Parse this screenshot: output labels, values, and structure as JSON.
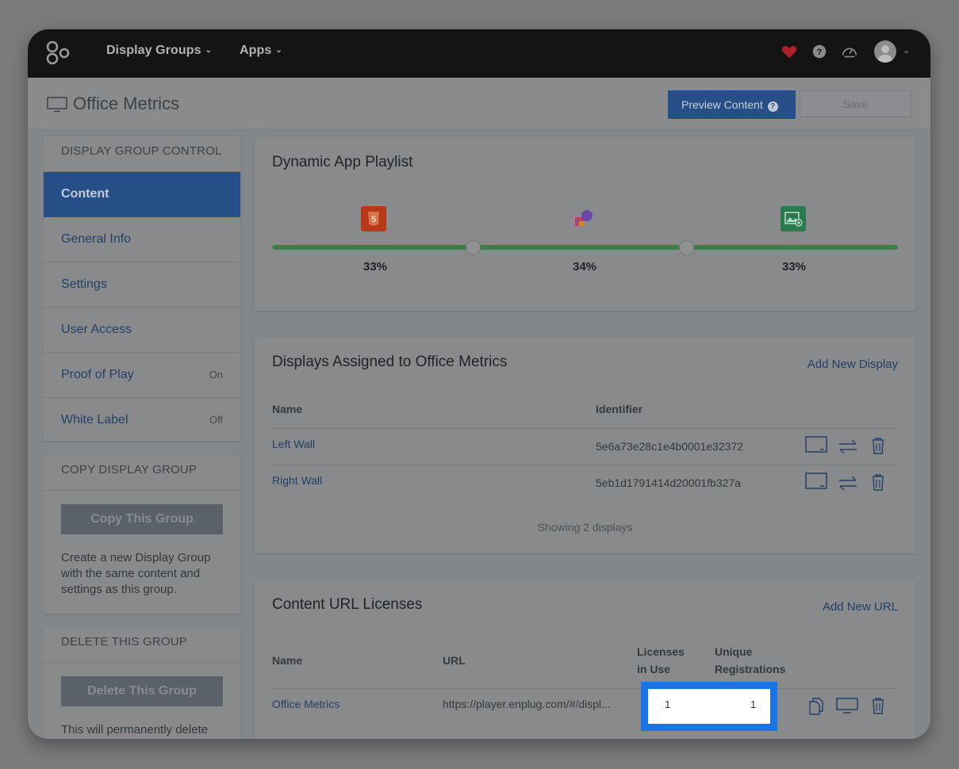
{
  "nav": {
    "items": [
      {
        "label": "Display Groups"
      },
      {
        "label": "Apps"
      }
    ]
  },
  "header": {
    "title": "Office Metrics",
    "preview_label": "Preview Content",
    "preview_help": "?",
    "save_label": "Save"
  },
  "sidebar": {
    "control_title": "DISPLAY GROUP CONTROL",
    "items": [
      {
        "label": "Content",
        "status": ""
      },
      {
        "label": "General Info",
        "status": ""
      },
      {
        "label": "Settings",
        "status": ""
      },
      {
        "label": "User Access",
        "status": ""
      },
      {
        "label": "Proof of Play",
        "status": "On"
      },
      {
        "label": "White Label",
        "status": "Off"
      }
    ],
    "copy": {
      "title": "COPY DISPLAY GROUP",
      "button": "Copy This Group",
      "text": "Create a new Display Group with the same content and settings as this group."
    },
    "delete": {
      "title": "DELETE THIS GROUP",
      "button": "Delete This Group",
      "text": "This will permanently delete"
    }
  },
  "playlist": {
    "title": "Dynamic App Playlist",
    "apps": [
      {
        "icon": "html5-app-icon",
        "percent": "33%",
        "share": 0.33,
        "color": "#b8391a"
      },
      {
        "icon": "shapes-app-icon",
        "percent": "34%",
        "share": 0.34,
        "color": "#7b4fb0"
      },
      {
        "icon": "image-app-icon",
        "percent": "33%",
        "share": 0.33,
        "color": "#2a7a4e"
      }
    ]
  },
  "displays": {
    "title": "Displays Assigned to Office Metrics",
    "add_label": "Add New Display",
    "columns": {
      "name": "Name",
      "identifier": "Identifier"
    },
    "rows": [
      {
        "name": "Left Wall",
        "identifier": "5e6a73e28c1e4b0001e32372"
      },
      {
        "name": "Right Wall",
        "identifier": "5eb1d1791414d20001fb327a"
      }
    ],
    "footer": "Showing 2 displays"
  },
  "licenses": {
    "title": "Content URL Licenses",
    "add_label": "Add New URL",
    "columns": {
      "name": "Name",
      "url": "URL",
      "licenses_line1": "Licenses",
      "licenses_line2": "in Use",
      "unique_line1": "Unique",
      "unique_line2": "Registrations"
    },
    "rows": [
      {
        "name": "Office Metrics",
        "url": "https://player.enplug.com/#/displ...",
        "licenses_in_use": "1",
        "unique_registrations": "1"
      }
    ]
  },
  "colors": {
    "primary": "#254f86",
    "accent_highlight": "#1a73e8",
    "slider": "#3e7c48",
    "nav_bg": "#141414",
    "heart": "#b0202a"
  }
}
